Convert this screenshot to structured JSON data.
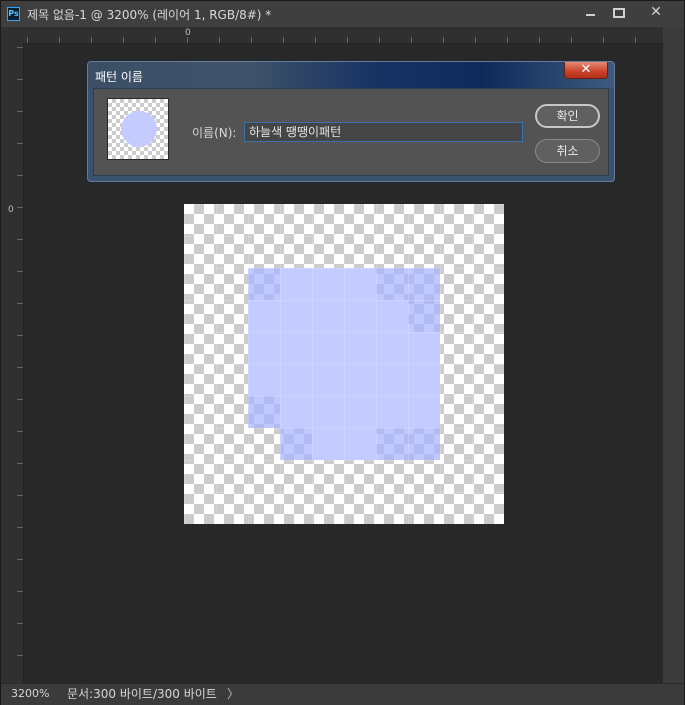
{
  "window": {
    "title": "제목 없음-1 @ 3200% (레이어 1, RGB/8#) *",
    "app_icon": "Ps"
  },
  "rulers": {
    "top_zero": "0",
    "left_zero": "0"
  },
  "dialog": {
    "title": "패턴 이름",
    "name_label": "이름(N):",
    "name_value": "하늘색 땡땡이패턴",
    "ok_label": "확인",
    "cancel_label": "취소",
    "close_label": "✕"
  },
  "canvas": {
    "pixel_color": "#c3cbff",
    "grid_size": 10
  },
  "status": {
    "zoom": "3200%",
    "doc_info": "문서:300 바이트/300 바이트",
    "arrow": "〉"
  }
}
